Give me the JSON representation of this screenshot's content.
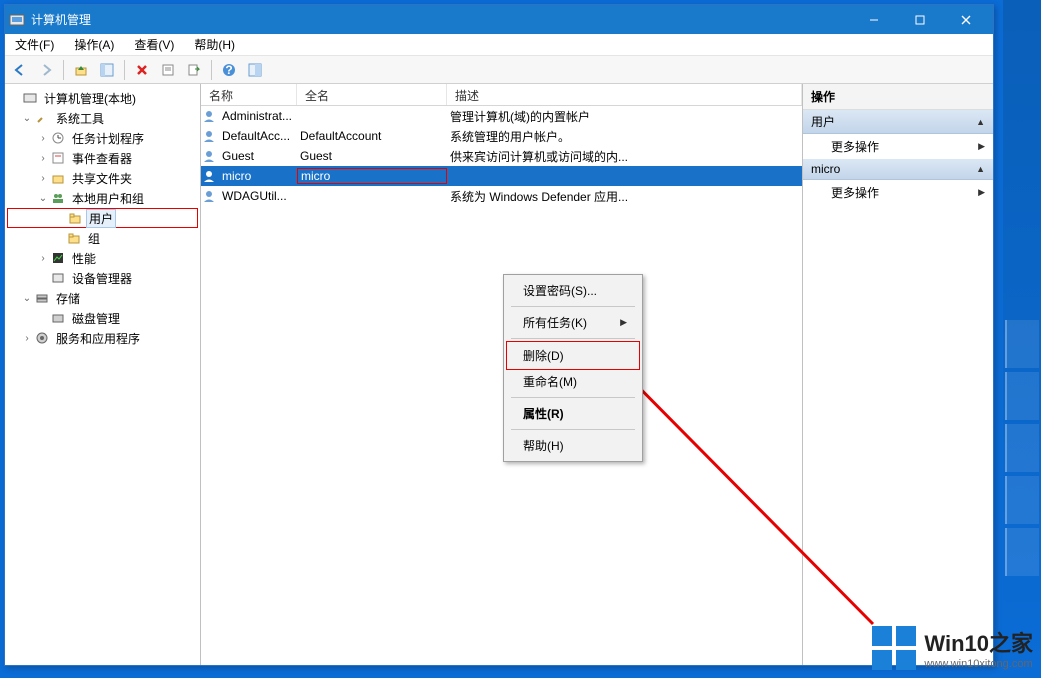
{
  "window": {
    "title": "计算机管理"
  },
  "menu": {
    "file": "文件(F)",
    "action": "操作(A)",
    "view": "查看(V)",
    "help": "帮助(H)"
  },
  "tree": {
    "root": "计算机管理(本地)",
    "sys_tools": "系统工具",
    "task_sched": "任务计划程序",
    "event_viewer": "事件查看器",
    "shared_folders": "共享文件夹",
    "local_users": "本地用户和组",
    "users": "用户",
    "groups": "组",
    "perf": "性能",
    "device_mgr": "设备管理器",
    "storage": "存储",
    "disk_mgmt": "磁盘管理",
    "services": "服务和应用程序"
  },
  "list": {
    "cols": {
      "name": "名称",
      "full": "全名",
      "desc": "描述"
    },
    "rows": [
      {
        "name": "Administrat...",
        "full": "",
        "desc": "管理计算机(域)的内置帐户"
      },
      {
        "name": "DefaultAcc...",
        "full": "DefaultAccount",
        "desc": "系统管理的用户帐户。"
      },
      {
        "name": "Guest",
        "full": "Guest",
        "desc": "供来宾访问计算机或访问域的内..."
      },
      {
        "name": "micro",
        "full": "micro",
        "desc": ""
      },
      {
        "name": "WDAGUtil...",
        "full": "",
        "desc": "系统为 Windows Defender 应用..."
      }
    ]
  },
  "ctx": {
    "set_pwd": "设置密码(S)...",
    "all_tasks": "所有任务(K)",
    "delete": "删除(D)",
    "rename": "重命名(M)",
    "props": "属性(R)",
    "help": "帮助(H)"
  },
  "actions": {
    "header": "操作",
    "users": "用户",
    "more": "更多操作",
    "micro": "micro"
  },
  "watermark": {
    "title": "Win10之家",
    "url": "www.win10xitong.com"
  }
}
